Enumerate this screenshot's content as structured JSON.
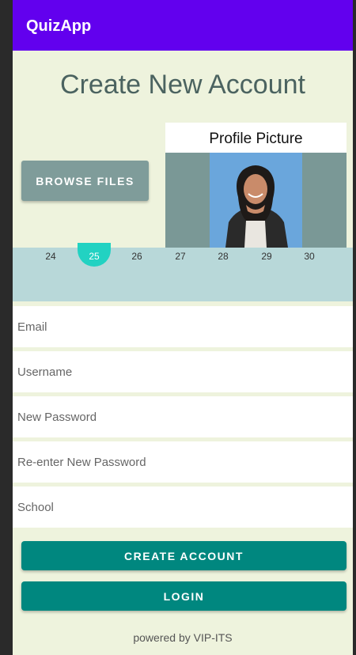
{
  "app_bar": {
    "title": "QuizApp"
  },
  "page": {
    "title": "Create New Account"
  },
  "upload": {
    "browse_label": "BROWSE FILES"
  },
  "profile": {
    "label": "Profile Picture"
  },
  "date_strip": {
    "days": [
      "24",
      "25",
      "26",
      "27",
      "28",
      "29",
      "30"
    ],
    "selected_day": "25"
  },
  "form": {
    "email_placeholder": "Email",
    "username_placeholder": "Username",
    "password_placeholder": "New Password",
    "reenter_placeholder": "Re-enter New Password",
    "school_placeholder": "School"
  },
  "buttons": {
    "create_label": "CREATE ACCOUNT",
    "login_label": "LOGIN"
  },
  "footer": {
    "text": "powered by VIP-ITS"
  },
  "colors": {
    "app_bar": "#6200ee",
    "background": "#eef3dd",
    "primary_button": "#00877f",
    "browse_button": "#7f9c9a",
    "date_selected": "#22d2c2"
  }
}
